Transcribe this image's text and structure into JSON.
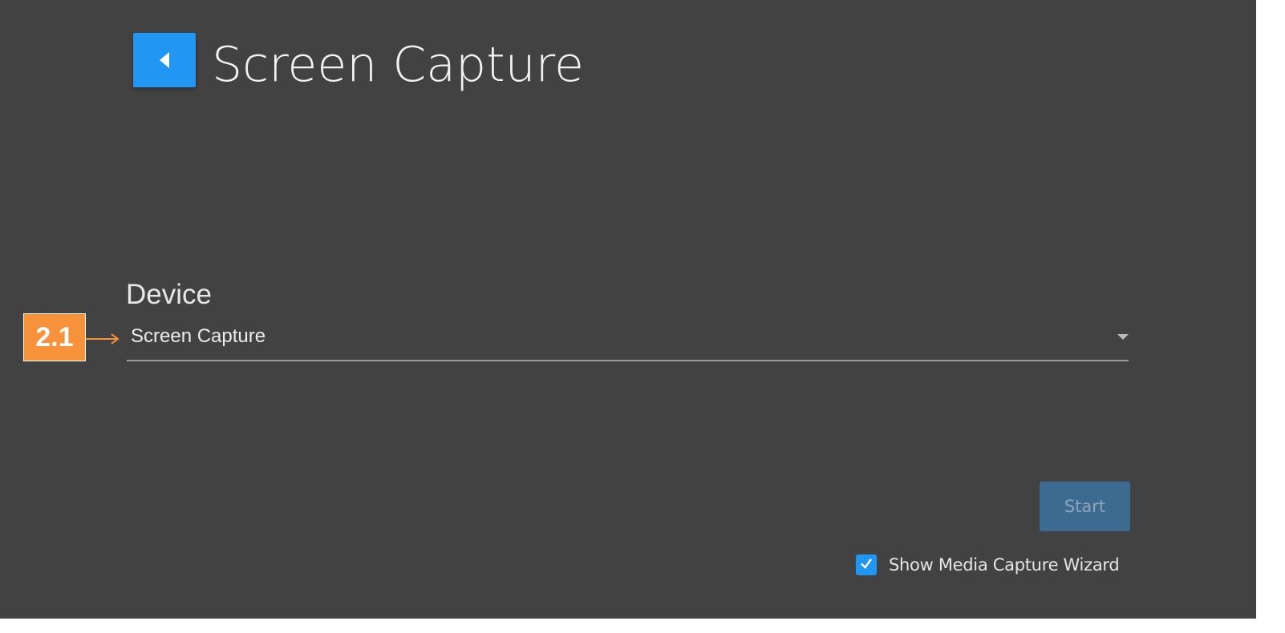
{
  "header": {
    "back_icon": "chevron-left-icon",
    "title": "Screen Capture"
  },
  "device": {
    "label": "Device",
    "selected_value": "Screen Capture",
    "dropdown_icon": "caret-down-icon"
  },
  "annotation": {
    "callout_label": "2.1",
    "callout_color": "#f7923a"
  },
  "actions": {
    "start_label": "Start",
    "start_disabled": true
  },
  "wizard": {
    "checked": true,
    "label": "Show Media Capture Wizard"
  },
  "colors": {
    "background": "#424242",
    "accent": "#2196f3"
  }
}
